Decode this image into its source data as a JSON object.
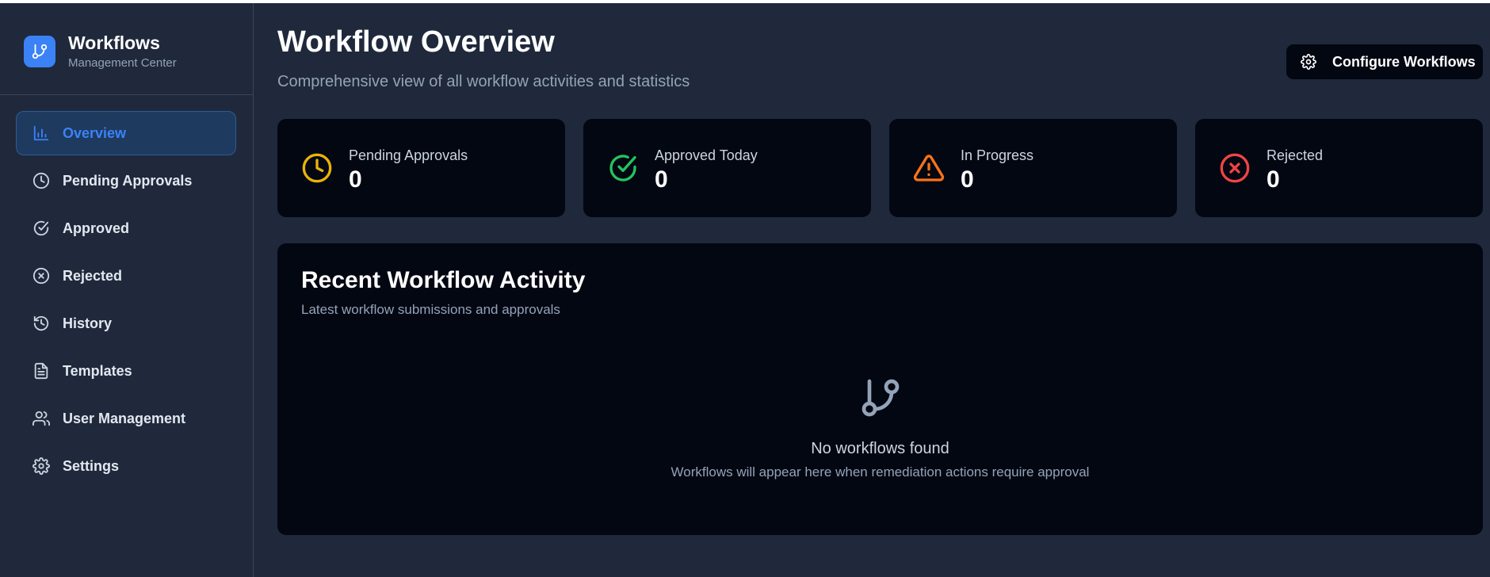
{
  "brand": {
    "title": "Workflows",
    "subtitle": "Management Center",
    "icon": "git-branch-icon",
    "accent": "#3b82f6"
  },
  "nav": [
    {
      "label": "Overview",
      "icon": "bar-chart-icon",
      "active": true
    },
    {
      "label": "Pending Approvals",
      "icon": "clock-icon"
    },
    {
      "label": "Approved",
      "icon": "check-circle-icon"
    },
    {
      "label": "Rejected",
      "icon": "x-circle-icon"
    },
    {
      "label": "History",
      "icon": "history-icon"
    },
    {
      "label": "Templates",
      "icon": "file-text-icon"
    },
    {
      "label": "User Management",
      "icon": "users-icon"
    },
    {
      "label": "Settings",
      "icon": "gear-icon"
    }
  ],
  "header": {
    "title": "Workflow Overview",
    "subtitle": "Comprehensive view of all workflow activities and statistics",
    "configure_label": "Configure Workflows"
  },
  "stats": [
    {
      "label": "Pending Approvals",
      "value": "0",
      "icon": "clock-icon",
      "color": "#eab308"
    },
    {
      "label": "Approved Today",
      "value": "0",
      "icon": "check-circle-icon",
      "color": "#22c55e"
    },
    {
      "label": "In Progress",
      "value": "0",
      "icon": "alert-triangle-icon",
      "color": "#f97316"
    },
    {
      "label": "Rejected",
      "value": "0",
      "icon": "x-circle-icon",
      "color": "#ef4444"
    }
  ],
  "activity": {
    "title": "Recent Workflow Activity",
    "subtitle": "Latest workflow submissions and approvals",
    "empty_title": "No workflows found",
    "empty_subtitle": "Workflows will appear here when remediation actions require approval"
  }
}
